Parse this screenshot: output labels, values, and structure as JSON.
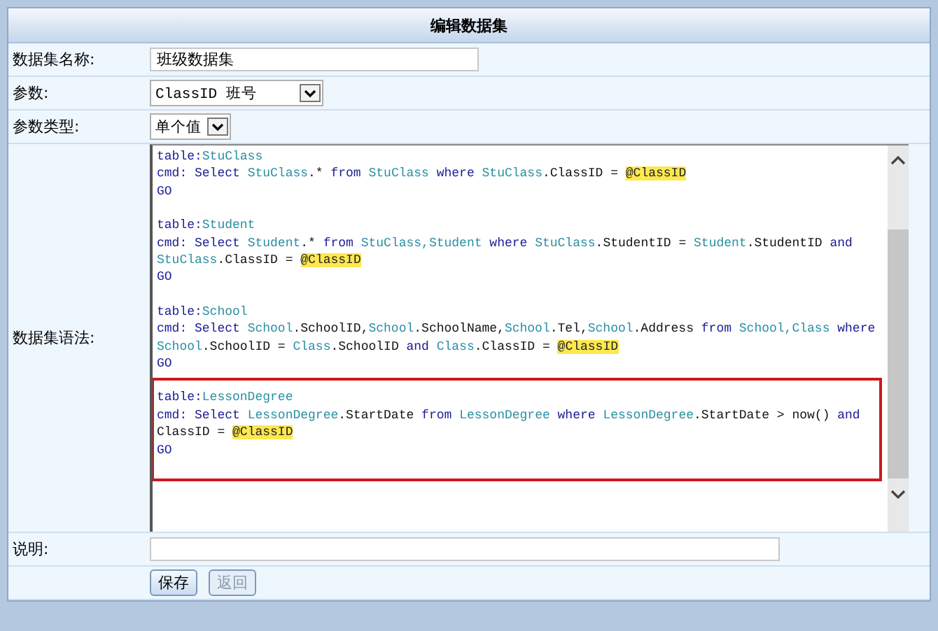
{
  "title": "编辑数据集",
  "fields": {
    "name": {
      "label": "数据集名称:",
      "value": "班级数据集"
    },
    "parameter": {
      "label": "参数:",
      "value": "ClassID 班号"
    },
    "parameter_type": {
      "label": "参数类型:",
      "value": "单个值"
    },
    "syntax": {
      "label": "数据集语法:"
    },
    "description": {
      "label": "说明:"
    }
  },
  "code": {
    "blocks": [
      {
        "highlighted": false,
        "lines": [
          [
            {
              "kind": "keyword",
              "text": "table:"
            },
            {
              "kind": "table",
              "text": "StuClass"
            }
          ],
          [
            {
              "kind": "keyword",
              "text": "cmd: Select "
            },
            {
              "kind": "table",
              "text": "StuClass"
            },
            {
              "kind": "plain",
              "text": ".* "
            },
            {
              "kind": "keyword",
              "text": "from "
            },
            {
              "kind": "table",
              "text": "StuClass "
            },
            {
              "kind": "keyword",
              "text": "where "
            },
            {
              "kind": "table",
              "text": "StuClass"
            },
            {
              "kind": "plain",
              "text": ".ClassID = "
            },
            {
              "kind": "param",
              "text": "@ClassID"
            }
          ],
          [
            {
              "kind": "keyword",
              "text": "GO"
            }
          ]
        ]
      },
      {
        "highlighted": false,
        "lines": [
          [
            {
              "kind": "keyword",
              "text": "table:"
            },
            {
              "kind": "table",
              "text": "Student"
            }
          ],
          [
            {
              "kind": "keyword",
              "text": "cmd: Select "
            },
            {
              "kind": "table",
              "text": "Student"
            },
            {
              "kind": "plain",
              "text": ".* "
            },
            {
              "kind": "keyword",
              "text": "from "
            },
            {
              "kind": "table",
              "text": "StuClass,Student "
            },
            {
              "kind": "keyword",
              "text": "where "
            },
            {
              "kind": "table",
              "text": "StuClass"
            },
            {
              "kind": "plain",
              "text": ".StudentID = "
            },
            {
              "kind": "table",
              "text": "Student"
            },
            {
              "kind": "plain",
              "text": ".StudentID "
            },
            {
              "kind": "keyword",
              "text": "and"
            }
          ],
          [
            {
              "kind": "table",
              "text": "StuClass"
            },
            {
              "kind": "plain",
              "text": ".ClassID = "
            },
            {
              "kind": "param",
              "text": "@ClassID"
            }
          ],
          [
            {
              "kind": "keyword",
              "text": "GO"
            }
          ]
        ]
      },
      {
        "highlighted": false,
        "lines": [
          [
            {
              "kind": "keyword",
              "text": "table:"
            },
            {
              "kind": "table",
              "text": "School"
            }
          ],
          [
            {
              "kind": "keyword",
              "text": "cmd: Select "
            },
            {
              "kind": "table",
              "text": "School"
            },
            {
              "kind": "plain",
              "text": ".SchoolID,"
            },
            {
              "kind": "table",
              "text": "School"
            },
            {
              "kind": "plain",
              "text": ".SchoolName,"
            },
            {
              "kind": "table",
              "text": "School"
            },
            {
              "kind": "plain",
              "text": ".Tel,"
            },
            {
              "kind": "table",
              "text": "School"
            },
            {
              "kind": "plain",
              "text": ".Address "
            },
            {
              "kind": "keyword",
              "text": "from "
            },
            {
              "kind": "table",
              "text": "School,Class "
            },
            {
              "kind": "keyword",
              "text": "where"
            }
          ],
          [
            {
              "kind": "table",
              "text": "School"
            },
            {
              "kind": "plain",
              "text": ".SchoolID = "
            },
            {
              "kind": "table",
              "text": "Class"
            },
            {
              "kind": "plain",
              "text": ".SchoolID "
            },
            {
              "kind": "keyword",
              "text": "and "
            },
            {
              "kind": "table",
              "text": "Class"
            },
            {
              "kind": "plain",
              "text": ".ClassID = "
            },
            {
              "kind": "param",
              "text": "@ClassID"
            }
          ],
          [
            {
              "kind": "keyword",
              "text": "GO"
            }
          ]
        ]
      },
      {
        "highlighted": true,
        "lines": [
          [
            {
              "kind": "keyword",
              "text": "table:"
            },
            {
              "kind": "table",
              "text": "LessonDegree"
            }
          ],
          [
            {
              "kind": "keyword",
              "text": "cmd: Select "
            },
            {
              "kind": "table",
              "text": "LessonDegree"
            },
            {
              "kind": "plain",
              "text": ".StartDate "
            },
            {
              "kind": "keyword",
              "text": "from "
            },
            {
              "kind": "table",
              "text": "LessonDegree "
            },
            {
              "kind": "keyword",
              "text": "where "
            },
            {
              "kind": "table",
              "text": "LessonDegree"
            },
            {
              "kind": "plain",
              "text": ".StartDate > now() "
            },
            {
              "kind": "keyword",
              "text": "and"
            }
          ],
          [
            {
              "kind": "plain",
              "text": "ClassID = "
            },
            {
              "kind": "param",
              "text": "@ClassID"
            }
          ],
          [
            {
              "kind": "keyword",
              "text": "GO"
            }
          ]
        ]
      }
    ]
  },
  "buttons": [
    {
      "label": "保存",
      "disabled": false
    },
    {
      "label": "返回",
      "disabled": true
    }
  ]
}
